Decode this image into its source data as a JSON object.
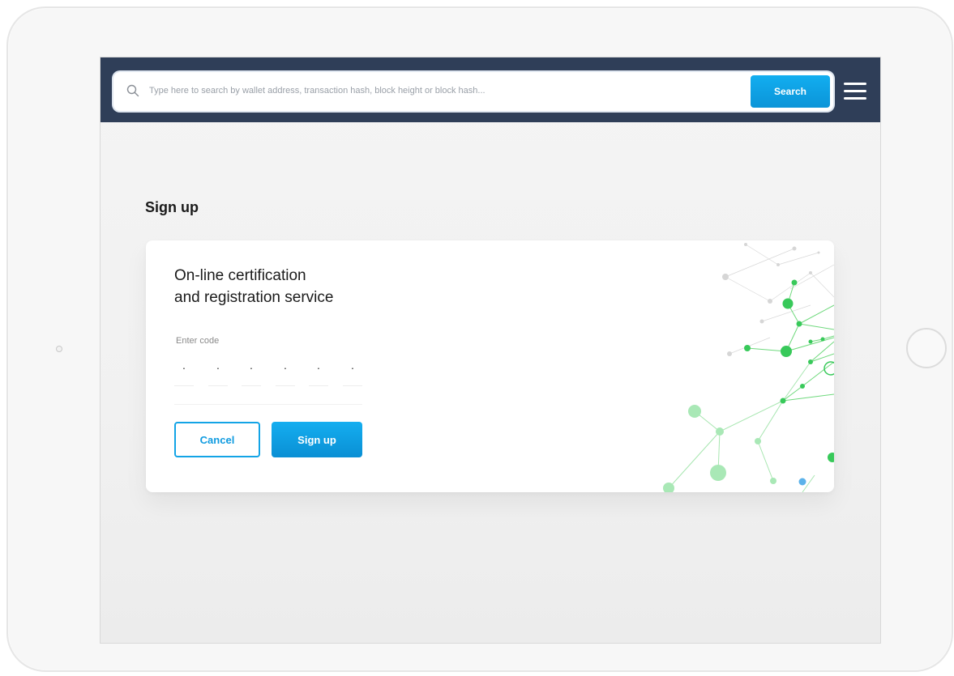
{
  "search": {
    "placeholder": "Type here to search by wallet address, transaction hash, block height or block hash...",
    "button_label": "Search",
    "icon": "search-icon"
  },
  "header": {
    "menu_icon": "hamburger-menu-icon"
  },
  "page": {
    "title": "Sign up"
  },
  "card": {
    "title_line1": "On-line certification",
    "title_line2": "and registration service",
    "code_label": "Enter code",
    "code_slots": [
      "·",
      "·",
      "·",
      "·",
      "·",
      "·"
    ],
    "cancel_label": "Cancel",
    "signup_label": "Sign up",
    "decoration": "network-graph-illustration"
  },
  "colors": {
    "topbar": "#2f3e58",
    "accent": "#12aef0",
    "network": "#34c759"
  }
}
